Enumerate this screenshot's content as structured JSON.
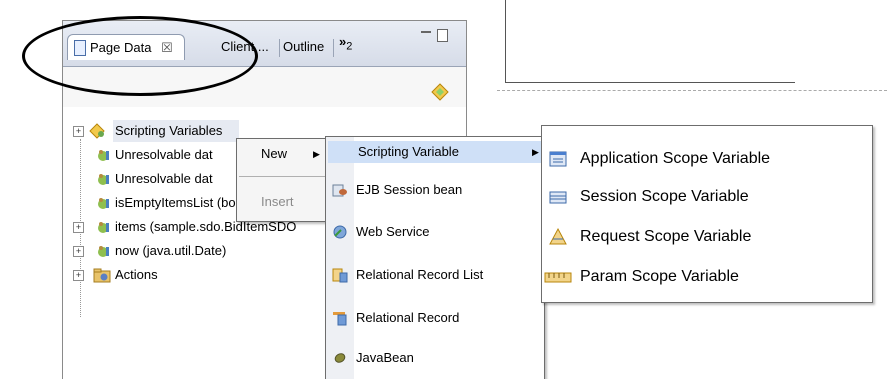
{
  "view": {
    "tabs": [
      {
        "label": "Page Data",
        "close": "☒"
      },
      {
        "label": "Client ..."
      },
      {
        "label": "Outline"
      },
      {
        "label": "»",
        "sub": "2"
      }
    ],
    "view_buttons": {
      "minimize": "–",
      "maximize": "□"
    }
  },
  "tree": {
    "items": [
      {
        "label": "Scripting Variables",
        "expander": "+"
      },
      {
        "label": "Unresolvable dat"
      },
      {
        "label": "Unresolvable dat"
      },
      {
        "label": "isEmptyItemsList (boolean)"
      },
      {
        "label": "items (sample.sdo.BidItemSDO",
        "expander": "+"
      },
      {
        "label": "now (java.util.Date)",
        "expander": "+"
      },
      {
        "label": "Actions",
        "expander": "+"
      }
    ]
  },
  "context_menu": {
    "items": [
      {
        "label": "New",
        "arrow": "▶"
      },
      {
        "label": "Insert"
      }
    ]
  },
  "new_submenu": {
    "items": [
      {
        "label": "Scripting Variable",
        "arrow": "▶"
      },
      {
        "label": "EJB Session bean"
      },
      {
        "label": "Web Service"
      },
      {
        "label": "Relational Record List"
      },
      {
        "label": "Relational Record"
      },
      {
        "label": "JavaBean"
      }
    ]
  },
  "scope_submenu": {
    "items": [
      {
        "label": "Application Scope Variable"
      },
      {
        "label": "Session Scope Variable"
      },
      {
        "label": "Request Scope Variable"
      },
      {
        "label": "Param Scope Variable"
      }
    ]
  },
  "colors": {
    "selection": "#cfe0f7",
    "tab_bar": "#d6dce8",
    "annotation": "#000000"
  }
}
